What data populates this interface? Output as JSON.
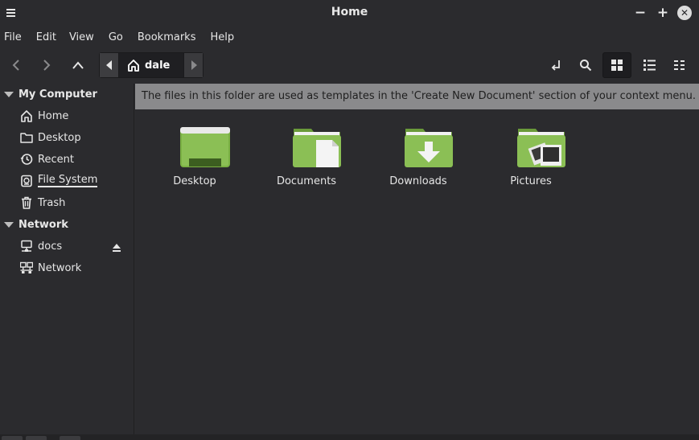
{
  "window": {
    "title": "Home"
  },
  "menu": [
    "File",
    "Edit",
    "View",
    "Go",
    "Bookmarks",
    "Help"
  ],
  "pathbar": {
    "current": "dale"
  },
  "sidebar": {
    "sections": [
      {
        "title": "My Computer",
        "items": [
          {
            "label": "Home",
            "icon": "home-icon"
          },
          {
            "label": "Desktop",
            "icon": "folder-icon"
          },
          {
            "label": "Recent",
            "icon": "recent-icon"
          },
          {
            "label": "File System",
            "icon": "drive-icon"
          },
          {
            "label": "Trash",
            "icon": "trash-icon"
          }
        ]
      },
      {
        "title": "Network",
        "items": [
          {
            "label": "docs",
            "icon": "network-share-icon"
          },
          {
            "label": "Network",
            "icon": "network-icon"
          }
        ]
      }
    ]
  },
  "infobar": {
    "text": "The files in this folder are used as templates in the 'Create New Document' section of your context menu."
  },
  "folders": [
    {
      "label": "Desktop",
      "icon": "desktop-folder-icon"
    },
    {
      "label": "Documents",
      "icon": "documents-folder-icon"
    },
    {
      "label": "Downloads",
      "icon": "downloads-folder-icon"
    },
    {
      "label": "Pictures",
      "icon": "pictures-folder-icon"
    }
  ],
  "colors": {
    "folder_green": "#8bbf55",
    "background": "#2b2b2e",
    "infobar": "#8a8a8c"
  }
}
